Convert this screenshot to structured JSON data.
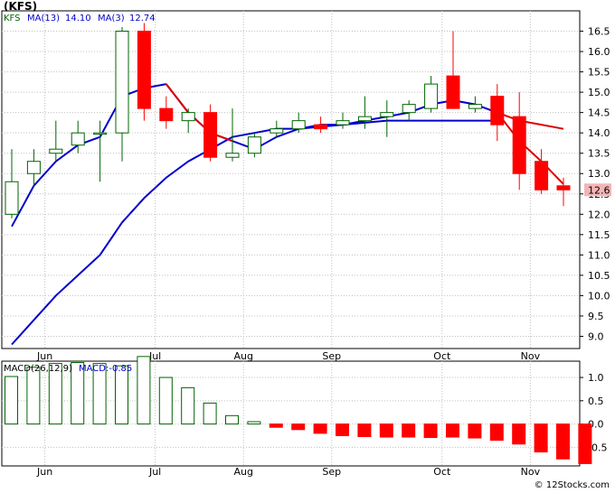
{
  "ticker_label": "(KFS)",
  "legend": {
    "symbol": "KFS",
    "ma13_label": "MA(13)",
    "ma13_value": "14.10",
    "ma3_label": "MA(3)",
    "ma3_value": "12.74"
  },
  "macd_legend": {
    "label": "MACD(26,12,9)",
    "value_label": "MACD:-0.85"
  },
  "price_badge": "12.6",
  "footer": "© 12Stocks.com",
  "colors": {
    "up": "#006400",
    "down": "#ff0000",
    "ma13": "#0000cc",
    "ma3": "#dd0000",
    "grid": "#c0c0c0",
    "badge_bg": "#f2b5b5",
    "macd_up_fill": "#ffffff"
  },
  "chart_data": [
    {
      "type": "candlestick",
      "y_ticks": [
        "9.0",
        "9.5",
        "10.0",
        "10.5",
        "11.0",
        "11.5",
        "12.0",
        "12.5",
        "13.0",
        "13.5",
        "14.0",
        "14.5",
        "15.0",
        "15.5",
        "16.0",
        "16.5"
      ],
      "ylim": [
        8.7,
        17.0
      ],
      "x_ticks": [
        "Jun",
        "Jul",
        "Aug",
        "Sep",
        "Oct",
        "Nov"
      ],
      "x_tick_positions": [
        1.5,
        6.5,
        10.5,
        14.5,
        19.5,
        23.5
      ],
      "candles": [
        {
          "o": 12.0,
          "h": 13.6,
          "l": 11.9,
          "c": 12.8
        },
        {
          "o": 13.0,
          "h": 13.6,
          "l": 12.7,
          "c": 13.3
        },
        {
          "o": 13.5,
          "h": 14.3,
          "l": 13.3,
          "c": 13.6
        },
        {
          "o": 13.7,
          "h": 14.3,
          "l": 13.5,
          "c": 14.0
        },
        {
          "o": 14.0,
          "h": 14.3,
          "l": 12.8,
          "c": 14.0
        },
        {
          "o": 14.0,
          "h": 16.6,
          "l": 13.3,
          "c": 16.5
        },
        {
          "o": 16.5,
          "h": 16.7,
          "l": 14.3,
          "c": 14.6
        },
        {
          "o": 14.6,
          "h": 14.9,
          "l": 14.1,
          "c": 14.3
        },
        {
          "o": 14.3,
          "h": 14.6,
          "l": 14.0,
          "c": 14.5
        },
        {
          "o": 14.5,
          "h": 14.7,
          "l": 13.3,
          "c": 13.4
        },
        {
          "o": 13.4,
          "h": 14.6,
          "l": 13.3,
          "c": 13.5
        },
        {
          "o": 13.5,
          "h": 14.0,
          "l": 13.4,
          "c": 13.9
        },
        {
          "o": 14.0,
          "h": 14.3,
          "l": 13.9,
          "c": 14.1
        },
        {
          "o": 14.1,
          "h": 14.5,
          "l": 14.0,
          "c": 14.3
        },
        {
          "o": 14.2,
          "h": 14.4,
          "l": 14.0,
          "c": 14.1
        },
        {
          "o": 14.2,
          "h": 14.5,
          "l": 14.1,
          "c": 14.3
        },
        {
          "o": 14.3,
          "h": 14.9,
          "l": 14.1,
          "c": 14.4
        },
        {
          "o": 14.4,
          "h": 14.8,
          "l": 13.9,
          "c": 14.5
        },
        {
          "o": 14.5,
          "h": 14.8,
          "l": 14.3,
          "c": 14.7
        },
        {
          "o": 14.6,
          "h": 15.4,
          "l": 14.5,
          "c": 15.2
        },
        {
          "o": 15.4,
          "h": 16.5,
          "l": 14.6,
          "c": 14.6
        },
        {
          "o": 14.6,
          "h": 14.9,
          "l": 14.5,
          "c": 14.7
        },
        {
          "o": 14.9,
          "h": 15.2,
          "l": 13.8,
          "c": 14.2
        },
        {
          "o": 14.4,
          "h": 15.0,
          "l": 12.6,
          "c": 13.0
        },
        {
          "o": 13.3,
          "h": 13.6,
          "l": 12.5,
          "c": 12.6
        },
        {
          "o": 12.7,
          "h": 12.9,
          "l": 12.2,
          "c": 12.6
        }
      ],
      "ma13": [
        {
          "x": 0,
          "y": 11.7
        },
        {
          "x": 1,
          "y": 12.7
        },
        {
          "x": 2,
          "y": 13.3
        },
        {
          "x": 3,
          "y": 13.7
        },
        {
          "x": 4,
          "y": 13.9
        },
        {
          "x": 5,
          "y": 14.9
        },
        {
          "x": 6,
          "y": 15.1
        },
        {
          "x": 7,
          "y": 15.2
        },
        {
          "x": 10,
          "y": 13.5
        },
        {
          "x": 11,
          "y": 13.8
        },
        {
          "x": 12,
          "y": 14.0
        },
        {
          "x": 13,
          "y": 14.2
        },
        {
          "x": 14,
          "y": 14.2
        },
        {
          "x": 15,
          "y": 14.25
        },
        {
          "x": 16,
          "y": 14.3
        },
        {
          "x": 17,
          "y": 14.4
        },
        {
          "x": 18,
          "y": 14.5
        },
        {
          "x": 19,
          "y": 14.8
        },
        {
          "x": 20,
          "y": 14.8
        },
        {
          "x": 21,
          "y": 14.7
        },
        {
          "x": 22,
          "y": 14.4
        }
      ],
      "ma13_tail": [
        {
          "x": 0,
          "y": 8.8
        },
        {
          "x": 1,
          "y": 9.4
        },
        {
          "x": 2,
          "y": 10.0
        },
        {
          "x": 3,
          "y": 10.5
        },
        {
          "x": 4,
          "y": 11.0
        },
        {
          "x": 5,
          "y": 11.8
        },
        {
          "x": 6,
          "y": 12.4
        },
        {
          "x": 7,
          "y": 12.9
        },
        {
          "x": 8,
          "y": 13.3
        },
        {
          "x": 9,
          "y": 13.6
        },
        {
          "x": 10,
          "y": 13.9
        },
        {
          "x": 11,
          "y": 14.0
        },
        {
          "x": 12,
          "y": 14.1
        },
        {
          "x": 13,
          "y": 14.1
        },
        {
          "x": 14,
          "y": 14.2
        },
        {
          "x": 15,
          "y": 14.2
        },
        {
          "x": 16,
          "y": 14.25
        },
        {
          "x": 17,
          "y": 14.3
        },
        {
          "x": 18,
          "y": 14.3
        },
        {
          "x": 19,
          "y": 14.3
        },
        {
          "x": 20,
          "y": 14.3
        },
        {
          "x": 21,
          "y": 14.3
        },
        {
          "x": 22,
          "y": 14.3
        }
      ],
      "ma3": [
        {
          "x": 7,
          "y": 15.2
        },
        {
          "x": 8,
          "y": 14.5
        },
        {
          "x": 9,
          "y": 14.0
        },
        {
          "x": 10,
          "y": 13.8
        },
        {
          "x": 11,
          "y": 13.6
        },
        {
          "x": 12,
          "y": 13.9
        },
        {
          "x": 13,
          "y": 14.1
        },
        {
          "x": 14,
          "y": 14.15
        },
        {
          "x": 15,
          "y": 14.2
        },
        {
          "x": 16,
          "y": 14.3
        },
        {
          "x": 17,
          "y": 14.4
        },
        {
          "x": 18,
          "y": 14.5
        },
        {
          "x": 19,
          "y": 14.7
        },
        {
          "x": 20,
          "y": 14.8
        },
        {
          "x": 21,
          "y": 14.7
        },
        {
          "x": 22,
          "y": 14.5
        },
        {
          "x": 23,
          "y": 14.3
        },
        {
          "x": 24,
          "y": 14.2
        },
        {
          "x": 25,
          "y": 14.1
        }
      ],
      "ma3_tail": [
        {
          "x": 22,
          "y": 14.5
        },
        {
          "x": 23,
          "y": 13.8
        },
        {
          "x": 24,
          "y": 13.3
        },
        {
          "x": 25,
          "y": 12.74
        }
      ],
      "grid": true
    },
    {
      "type": "bar",
      "title": "MACD(26,12,9)",
      "y_ticks": [
        "1.0",
        "0.5",
        "0.0",
        "-0.5"
      ],
      "ylim": [
        -0.9,
        1.35
      ],
      "x_ticks": [
        "Jun",
        "Jul",
        "Aug",
        "Sep",
        "Oct",
        "Nov"
      ],
      "values": [
        1.02,
        1.22,
        1.3,
        1.32,
        1.3,
        1.25,
        1.45,
        1.0,
        0.78,
        0.45,
        0.18,
        0.05,
        -0.07,
        -0.12,
        -0.2,
        -0.25,
        -0.27,
        -0.28,
        -0.28,
        -0.29,
        -0.28,
        -0.3,
        -0.35,
        -0.43,
        -0.6,
        -0.75,
        -0.85
      ],
      "grid": true
    }
  ]
}
